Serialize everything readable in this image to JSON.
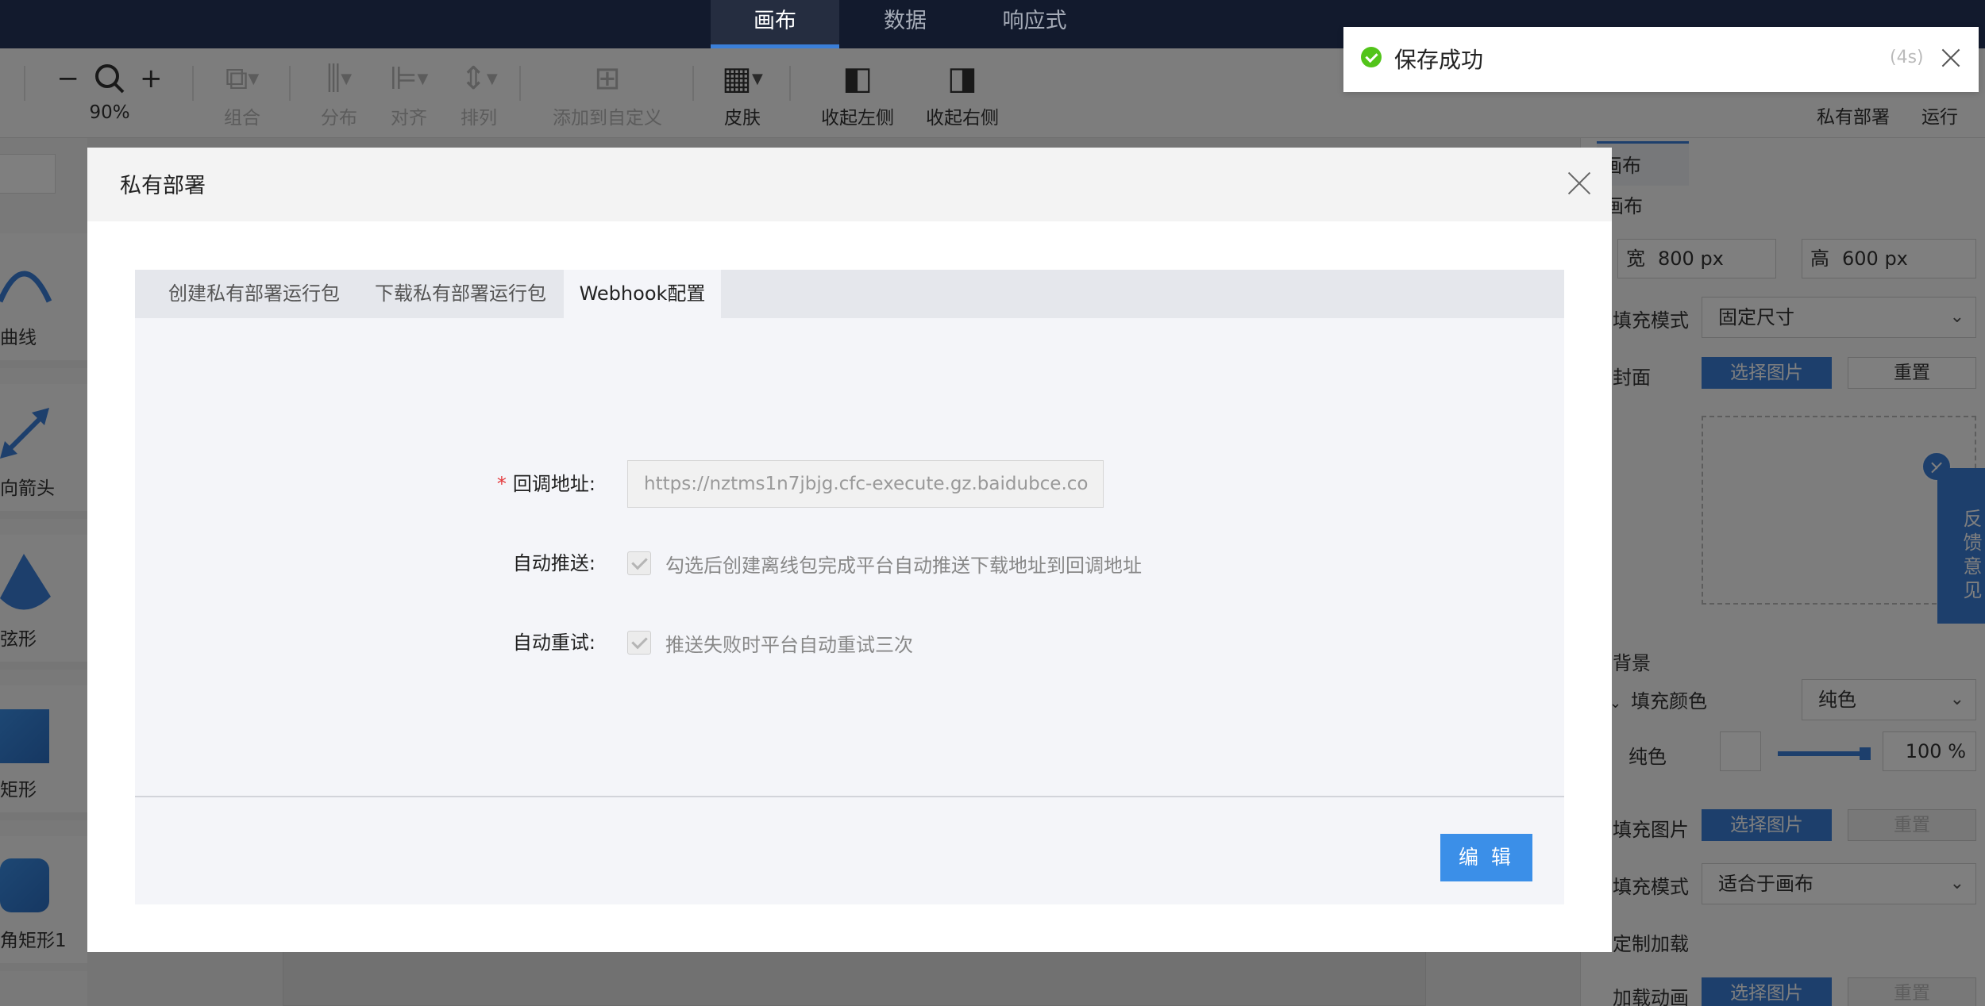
{
  "topbar": {
    "tabs": [
      {
        "label": "画布"
      },
      {
        "label": "数据"
      },
      {
        "label": "响应式"
      }
    ]
  },
  "toolbar": {
    "zoom": "90%",
    "zoom_out": "−",
    "zoom_in": "+",
    "group": "组合",
    "distribute": "分布",
    "align": "对齐",
    "arrange": "排列",
    "add_custom": "添加到自定义",
    "skin": "皮肤",
    "collapse_left": "收起左侧",
    "collapse_right": "收起右侧",
    "private_deploy": "私有部署",
    "run": "运行"
  },
  "left_panel": {
    "items": [
      {
        "label": "曲线"
      },
      {
        "label": "向箭头"
      },
      {
        "label": "弦形"
      },
      {
        "label": "矩形"
      },
      {
        "label": "角矩形1"
      }
    ]
  },
  "right_panel": {
    "tab": "画布",
    "section_canvas": "画布",
    "width_label": "宽",
    "width_value": "800 px",
    "height_label": "高",
    "height_value": "600 px",
    "fill_mode_label": "填充模式",
    "fill_mode_value": "固定尺寸",
    "cover_label": "封面",
    "select_image": "选择图片",
    "reset": "重置",
    "background_label": "背景",
    "fill_color_label": "填充颜色",
    "fill_color_value": "纯色",
    "solid_label": "纯色",
    "opacity_value": "100 %",
    "opacity_level": 1.0,
    "fill_image_label": "填充图片",
    "fill_mode2_label": "填充模式",
    "fill_mode2_value": "适合于画布",
    "custom_loading_label": "定制加载",
    "loading_anim_label": "加载动画",
    "feedback": "反馈意见"
  },
  "modal": {
    "title": "私有部署",
    "tabs": [
      {
        "label": "创建私有部署运行包"
      },
      {
        "label": "下载私有部署运行包"
      },
      {
        "label": "Webhook配置"
      }
    ],
    "callback_label": "回调地址:",
    "callback_value": "https://nztms1n7jbjg.cfc-execute.gz.baidubce.co",
    "auto_push_label": "自动推送:",
    "auto_push_text": "勾选后创建离线包完成平台自动推送下载地址到回调地址",
    "auto_retry_label": "自动重试:",
    "auto_retry_text": "推送失败时平台自动重试三次",
    "edit_button": "编 辑"
  },
  "toast": {
    "message": "保存成功",
    "timer": "(4s)"
  }
}
